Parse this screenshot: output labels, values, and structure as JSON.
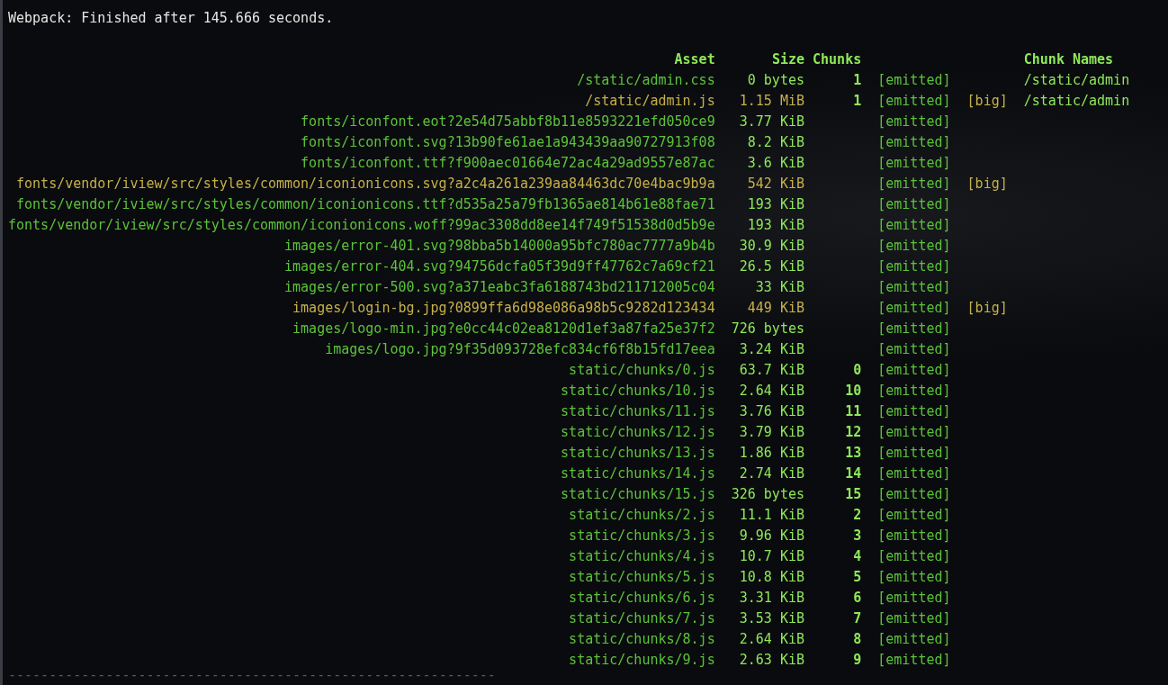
{
  "status_line": "Webpack: Finished after 145.666 seconds.",
  "columns": [
    "Asset",
    "Size",
    "Chunks",
    "Chunk Names"
  ],
  "assets": [
    {
      "asset": "/static/admin.css",
      "size": "0 bytes",
      "chunks": "1",
      "status": "[emitted]",
      "big": false,
      "chunk_names": "/static/admin"
    },
    {
      "asset": "/static/admin.js",
      "size": "1.15 MiB",
      "chunks": "1",
      "status": "[emitted]",
      "big": true,
      "tag": "[big]",
      "chunk_names": "/static/admin"
    },
    {
      "asset": "fonts/iconfont.eot?2e54d75abbf8b11e8593221efd050ce9",
      "size": "3.77 KiB",
      "status": "[emitted]",
      "big": false
    },
    {
      "asset": "fonts/iconfont.svg?13b90fe61ae1a943439aa90727913f08",
      "size": "8.2 KiB",
      "status": "[emitted]",
      "big": false
    },
    {
      "asset": "fonts/iconfont.ttf?f900aec01664e72ac4a29ad9557e87ac",
      "size": "3.6 KiB",
      "status": "[emitted]",
      "big": false
    },
    {
      "asset": "fonts/vendor/iview/src/styles/common/iconionicons.svg?a2c4a261a239aa84463dc70e4bac9b9a",
      "size": "542 KiB",
      "status": "[emitted]",
      "big": true,
      "tag": "[big]"
    },
    {
      "asset": "fonts/vendor/iview/src/styles/common/iconionicons.ttf?d535a25a79fb1365ae814b61e88fae71",
      "size": "193 KiB",
      "status": "[emitted]",
      "big": false
    },
    {
      "asset": "fonts/vendor/iview/src/styles/common/iconionicons.woff?99ac3308dd8ee14f749f51538d0d5b9e",
      "size": "193 KiB",
      "status": "[emitted]",
      "big": false
    },
    {
      "asset": "images/error-401.svg?98bba5b14000a95bfc780ac7777a9b4b",
      "size": "30.9 KiB",
      "status": "[emitted]",
      "big": false
    },
    {
      "asset": "images/error-404.svg?94756dcfa05f39d9ff47762c7a69cf21",
      "size": "26.5 KiB",
      "status": "[emitted]",
      "big": false
    },
    {
      "asset": "images/error-500.svg?a371eabc3fa6188743bd211712005c04",
      "size": "33 KiB",
      "status": "[emitted]",
      "big": false
    },
    {
      "asset": "images/login-bg.jpg?0899ffa6d98e086a98b5c9282d123434",
      "size": "449 KiB",
      "status": "[emitted]",
      "big": true,
      "tag": "[big]"
    },
    {
      "asset": "images/logo-min.jpg?e0cc44c02ea8120d1ef3a87fa25e37f2",
      "size": "726 bytes",
      "status": "[emitted]",
      "big": false
    },
    {
      "asset": "images/logo.jpg?9f35d093728efc834cf6f8b15fd17eea",
      "size": "3.24 KiB",
      "status": "[emitted]",
      "big": false
    },
    {
      "asset": "static/chunks/0.js",
      "size": "63.7 KiB",
      "chunks": "0",
      "status": "[emitted]",
      "big": false
    },
    {
      "asset": "static/chunks/10.js",
      "size": "2.64 KiB",
      "chunks": "10",
      "status": "[emitted]",
      "big": false
    },
    {
      "asset": "static/chunks/11.js",
      "size": "3.76 KiB",
      "chunks": "11",
      "status": "[emitted]",
      "big": false
    },
    {
      "asset": "static/chunks/12.js",
      "size": "3.79 KiB",
      "chunks": "12",
      "status": "[emitted]",
      "big": false
    },
    {
      "asset": "static/chunks/13.js",
      "size": "1.86 KiB",
      "chunks": "13",
      "status": "[emitted]",
      "big": false
    },
    {
      "asset": "static/chunks/14.js",
      "size": "2.74 KiB",
      "chunks": "14",
      "status": "[emitted]",
      "big": false
    },
    {
      "asset": "static/chunks/15.js",
      "size": "326 bytes",
      "chunks": "15",
      "status": "[emitted]",
      "big": false
    },
    {
      "asset": "static/chunks/2.js",
      "size": "11.1 KiB",
      "chunks": "2",
      "status": "[emitted]",
      "big": false
    },
    {
      "asset": "static/chunks/3.js",
      "size": "9.96 KiB",
      "chunks": "3",
      "status": "[emitted]",
      "big": false
    },
    {
      "asset": "static/chunks/4.js",
      "size": "10.7 KiB",
      "chunks": "4",
      "status": "[emitted]",
      "big": false
    },
    {
      "asset": "static/chunks/5.js",
      "size": "10.8 KiB",
      "chunks": "5",
      "status": "[emitted]",
      "big": false
    },
    {
      "asset": "static/chunks/6.js",
      "size": "3.31 KiB",
      "chunks": "6",
      "status": "[emitted]",
      "big": false
    },
    {
      "asset": "static/chunks/7.js",
      "size": "3.53 KiB",
      "chunks": "7",
      "status": "[emitted]",
      "big": false
    },
    {
      "asset": "static/chunks/8.js",
      "size": "2.64 KiB",
      "chunks": "8",
      "status": "[emitted]",
      "big": false
    },
    {
      "asset": "static/chunks/9.js",
      "size": "2.63 KiB",
      "chunks": "9",
      "status": "[emitted]",
      "big": false
    }
  ],
  "separator": "------------------------------------------------------------"
}
